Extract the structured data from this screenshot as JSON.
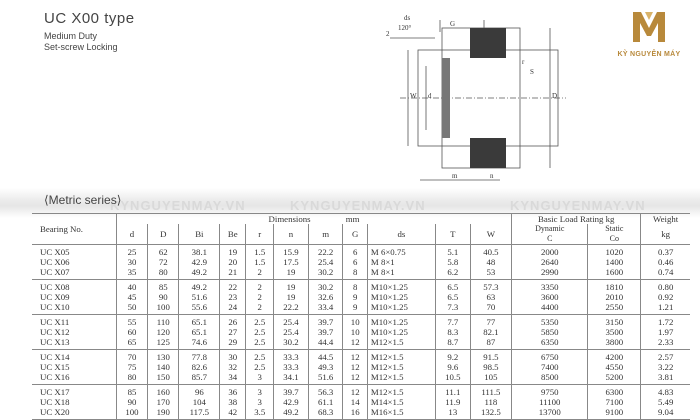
{
  "header": {
    "title": "UC X00 type",
    "line1": "Medium Duty",
    "line2": "Set-screw Locking"
  },
  "logo": {
    "brand": "KỲ NGUYÊN MÁY",
    "accent_color": "#b8893b"
  },
  "drawing_labels": {
    "ds": "ds",
    "angle": "120°",
    "two": "2",
    "g": "G",
    "s": "S",
    "w": "W",
    "d": "d",
    "D": "D",
    "r": "r",
    "m": "m",
    "n": "n",
    "bi": "Bi"
  },
  "watermark": "KYNGUYENMAY.VN",
  "section_title": "⟨Metric series⟩",
  "table": {
    "col_bearing": "Bearing No.",
    "col_dimensions": "Dimensions",
    "col_mm": "mm",
    "col_load": "Basic Load Rating kg",
    "col_weight": "Weight",
    "col_weight_unit": "kg",
    "sub": [
      "d",
      "D",
      "Bi",
      "Be",
      "r",
      "n",
      "m",
      "G",
      "ds",
      "T",
      "W"
    ],
    "dynamic": "Dynamic",
    "dynamic_c": "C",
    "static": "Static",
    "static_co": "Co",
    "groups": [
      [
        [
          "UC X05",
          "25",
          "62",
          "38.1",
          "19",
          "1.5",
          "15.9",
          "22.2",
          "6",
          "M 6×0.75",
          "5.1",
          "40.5",
          "2000",
          "1020",
          "0.37"
        ],
        [
          "UC X06",
          "30",
          "72",
          "42.9",
          "20",
          "1.5",
          "17.5",
          "25.4",
          "6",
          "M 8×1",
          "5.8",
          "48",
          "2640",
          "1400",
          "0.46"
        ],
        [
          "UC X07",
          "35",
          "80",
          "49.2",
          "21",
          "2",
          "19",
          "30.2",
          "8",
          "M 8×1",
          "6.2",
          "53",
          "2990",
          "1600",
          "0.74"
        ]
      ],
      [
        [
          "UC X08",
          "40",
          "85",
          "49.2",
          "22",
          "2",
          "19",
          "30.2",
          "8",
          "M10×1.25",
          "6.5",
          "57.3",
          "3350",
          "1810",
          "0.80"
        ],
        [
          "UC X09",
          "45",
          "90",
          "51.6",
          "23",
          "2",
          "19",
          "32.6",
          "9",
          "M10×1.25",
          "6.5",
          "63",
          "3600",
          "2010",
          "0.92"
        ],
        [
          "UC X10",
          "50",
          "100",
          "55.6",
          "24",
          "2",
          "22.2",
          "33.4",
          "9",
          "M10×1.25",
          "7.3",
          "70",
          "4400",
          "2550",
          "1.21"
        ]
      ],
      [
        [
          "UC X11",
          "55",
          "110",
          "65.1",
          "26",
          "2.5",
          "25.4",
          "39.7",
          "10",
          "M10×1.25",
          "7.7",
          "77",
          "5350",
          "3150",
          "1.72"
        ],
        [
          "UC X12",
          "60",
          "120",
          "65.1",
          "27",
          "2.5",
          "25.4",
          "39.7",
          "10",
          "M10×1.25",
          "8.3",
          "82.1",
          "5850",
          "3500",
          "1.97"
        ],
        [
          "UC X13",
          "65",
          "125",
          "74.6",
          "29",
          "2.5",
          "30.2",
          "44.4",
          "12",
          "M12×1.5",
          "8.7",
          "87",
          "6350",
          "3800",
          "2.33"
        ]
      ],
      [
        [
          "UC X14",
          "70",
          "130",
          "77.8",
          "30",
          "2.5",
          "33.3",
          "44.5",
          "12",
          "M12×1.5",
          "9.2",
          "91.5",
          "6750",
          "4200",
          "2.57"
        ],
        [
          "UC X15",
          "75",
          "140",
          "82.6",
          "32",
          "2.5",
          "33.3",
          "49.3",
          "12",
          "M12×1.5",
          "9.6",
          "98.5",
          "7400",
          "4550",
          "3.22"
        ],
        [
          "UC X16",
          "80",
          "150",
          "85.7",
          "34",
          "3",
          "34.1",
          "51.6",
          "12",
          "M12×1.5",
          "10.5",
          "105",
          "8500",
          "5200",
          "3.81"
        ]
      ],
      [
        [
          "UC X17",
          "85",
          "160",
          "96",
          "36",
          "3",
          "39.7",
          "56.3",
          "12",
          "M12×1.5",
          "11.1",
          "111.5",
          "9750",
          "6300",
          "4.83"
        ],
        [
          "UC X18",
          "90",
          "170",
          "104",
          "38",
          "3",
          "42.9",
          "61.1",
          "14",
          "M14×1.5",
          "11.9",
          "118",
          "11100",
          "7100",
          "5.49"
        ],
        [
          "UC X20",
          "100",
          "190",
          "117.5",
          "42",
          "3.5",
          "49.2",
          "68.3",
          "16",
          "M16×1.5",
          "13",
          "132.5",
          "13700",
          "9100",
          "9.04"
        ]
      ]
    ]
  }
}
